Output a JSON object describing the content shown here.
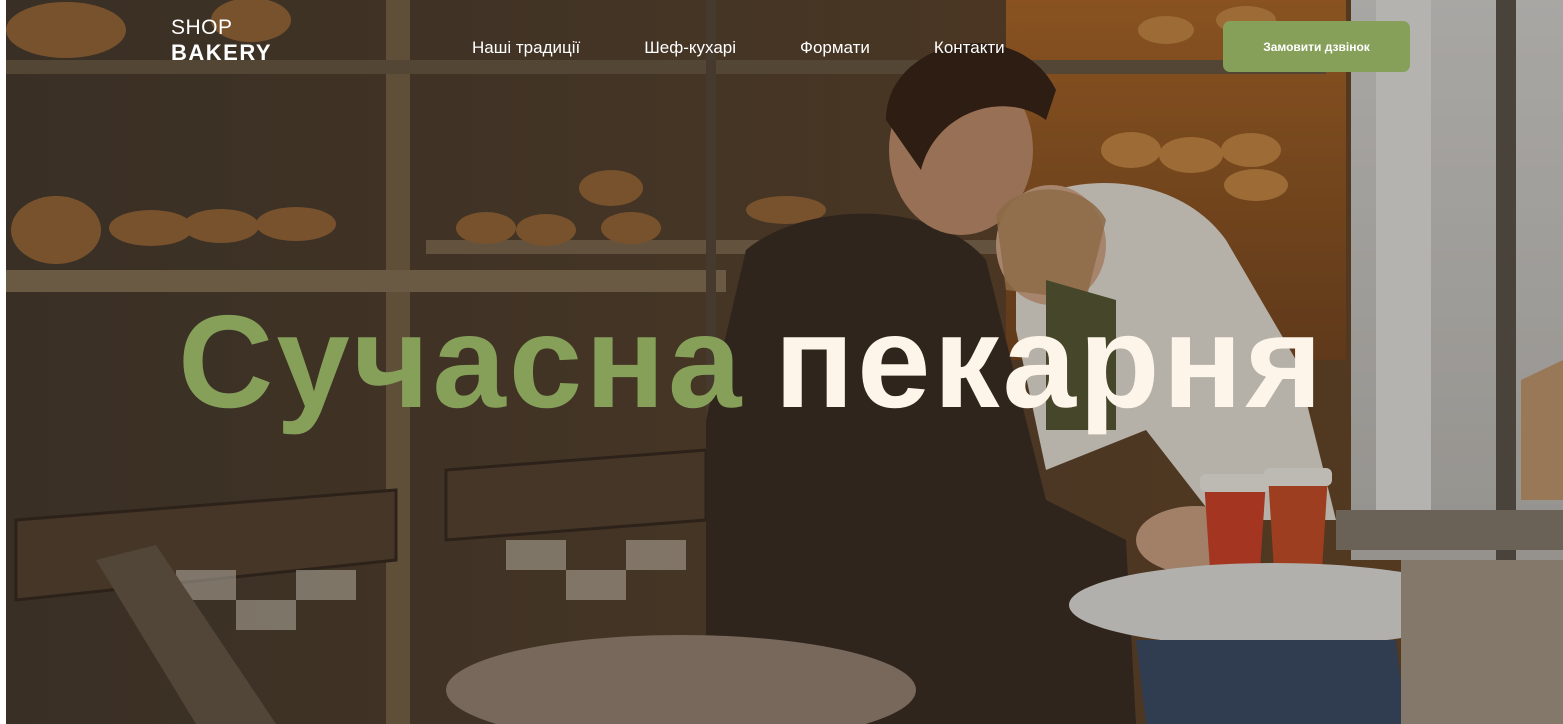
{
  "brand": {
    "line1": "SHOP",
    "line2": "BAKERY"
  },
  "nav": {
    "items": [
      {
        "label": "Наші традиції"
      },
      {
        "label": "Шеф-кухарі"
      },
      {
        "label": "Формати"
      },
      {
        "label": "Контакти"
      }
    ]
  },
  "cta": {
    "label": "Замовити дзвінок"
  },
  "hero": {
    "title_part1": "Сучасна",
    "title_part2": "пекарня"
  },
  "colors": {
    "accent_green": "#86a05a",
    "headline_cream": "#fdf5ea",
    "text_white": "#ffffff"
  }
}
